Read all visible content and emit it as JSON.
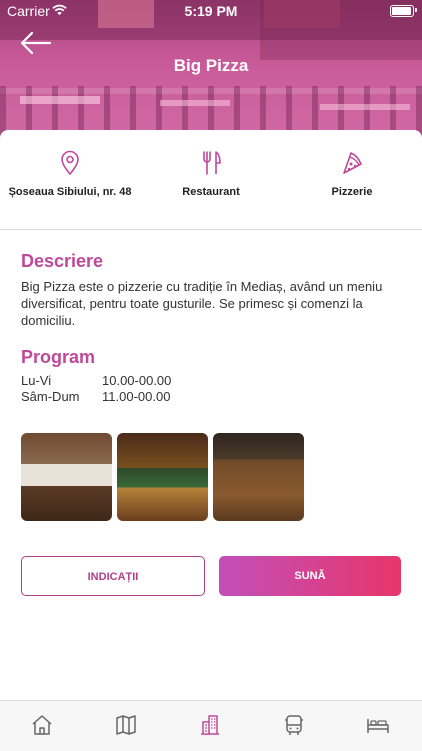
{
  "status_bar": {
    "carrier": "Carrier",
    "time": "5:19 PM"
  },
  "header": {
    "title": "Big Pizza"
  },
  "features": [
    {
      "icon": "location-pin-icon",
      "label": "Șoseaua Sibiului, nr. 48"
    },
    {
      "icon": "fork-knife-icon",
      "label": "Restaurant"
    },
    {
      "icon": "pizza-slice-icon",
      "label": "Pizzerie"
    }
  ],
  "description": {
    "heading": "Descriere",
    "text": "Big Pizza este o pizzerie cu tradiție în Mediaș, având un meniu diversificat, pentru toate gusturile. Se primesc și comenzi la domiciliu."
  },
  "program": {
    "heading": "Program",
    "rows": [
      {
        "days": "Lu-Vi",
        "hours": "10.00-00.00"
      },
      {
        "days": "Sâm-Dum",
        "hours": "11.00-00.00"
      }
    ]
  },
  "buttons": {
    "directions": "INDICAȚII",
    "call": "SUNĂ"
  },
  "tabbar": {
    "active_index": 2,
    "icons": [
      "home-icon",
      "map-icon",
      "building-icon",
      "bus-icon",
      "bed-icon"
    ]
  },
  "colors": {
    "accent": "#c0489a",
    "call_gradient_start": "#c34fba",
    "call_gradient_end": "#e6366a",
    "tab_active": "#c0489a",
    "tab_inactive": "#666666"
  }
}
